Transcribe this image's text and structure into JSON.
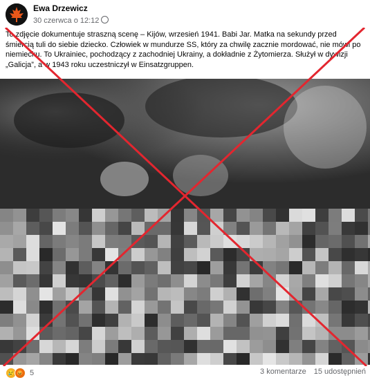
{
  "author": {
    "name": "Ewa Drzewicz",
    "date": "30 czerwca o 12:12"
  },
  "caption": "To zdjęcie dokumentuje straszną scenę – Kijów, wrzesień 1941. Babi Jar. Matka na sekundy przed śmiercią tuli do siebie dziecko. Człowiek w mundurze SS, który za chwilę zacznie mordować, nie mówi po niemiecku. To Ukrainiec, pochodzący z zachodniej Ukrainy, a dokładnie z Żytomierza. Służył w dywizji „Galicja”, a w 1943 roku uczestniczył w Einsatzgruppen.",
  "footer": {
    "reaction_count": "5",
    "comments": "3 komentarze",
    "shares": "15 udostępnień"
  },
  "icons": {
    "avatar": "maple-leaf-avatar",
    "reactions": [
      "sad-reaction-icon",
      "angry-reaction-icon"
    ],
    "overlay": "red-cross-mark"
  },
  "colors": {
    "cross": "#e3262f",
    "text_secondary": "#65676b"
  }
}
